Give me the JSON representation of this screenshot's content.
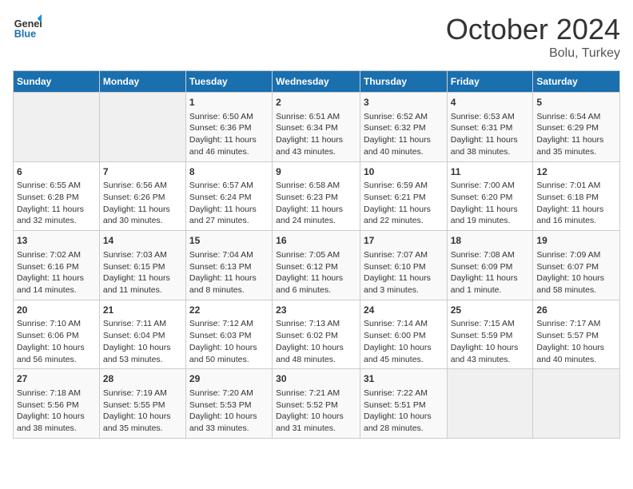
{
  "header": {
    "logo_line1": "General",
    "logo_line2": "Blue",
    "month": "October 2024",
    "location": "Bolu, Turkey"
  },
  "weekdays": [
    "Sunday",
    "Monday",
    "Tuesday",
    "Wednesday",
    "Thursday",
    "Friday",
    "Saturday"
  ],
  "weeks": [
    [
      {
        "day": "",
        "info": ""
      },
      {
        "day": "",
        "info": ""
      },
      {
        "day": "1",
        "info": "Sunrise: 6:50 AM\nSunset: 6:36 PM\nDaylight: 11 hours and 46 minutes."
      },
      {
        "day": "2",
        "info": "Sunrise: 6:51 AM\nSunset: 6:34 PM\nDaylight: 11 hours and 43 minutes."
      },
      {
        "day": "3",
        "info": "Sunrise: 6:52 AM\nSunset: 6:32 PM\nDaylight: 11 hours and 40 minutes."
      },
      {
        "day": "4",
        "info": "Sunrise: 6:53 AM\nSunset: 6:31 PM\nDaylight: 11 hours and 38 minutes."
      },
      {
        "day": "5",
        "info": "Sunrise: 6:54 AM\nSunset: 6:29 PM\nDaylight: 11 hours and 35 minutes."
      }
    ],
    [
      {
        "day": "6",
        "info": "Sunrise: 6:55 AM\nSunset: 6:28 PM\nDaylight: 11 hours and 32 minutes."
      },
      {
        "day": "7",
        "info": "Sunrise: 6:56 AM\nSunset: 6:26 PM\nDaylight: 11 hours and 30 minutes."
      },
      {
        "day": "8",
        "info": "Sunrise: 6:57 AM\nSunset: 6:24 PM\nDaylight: 11 hours and 27 minutes."
      },
      {
        "day": "9",
        "info": "Sunrise: 6:58 AM\nSunset: 6:23 PM\nDaylight: 11 hours and 24 minutes."
      },
      {
        "day": "10",
        "info": "Sunrise: 6:59 AM\nSunset: 6:21 PM\nDaylight: 11 hours and 22 minutes."
      },
      {
        "day": "11",
        "info": "Sunrise: 7:00 AM\nSunset: 6:20 PM\nDaylight: 11 hours and 19 minutes."
      },
      {
        "day": "12",
        "info": "Sunrise: 7:01 AM\nSunset: 6:18 PM\nDaylight: 11 hours and 16 minutes."
      }
    ],
    [
      {
        "day": "13",
        "info": "Sunrise: 7:02 AM\nSunset: 6:16 PM\nDaylight: 11 hours and 14 minutes."
      },
      {
        "day": "14",
        "info": "Sunrise: 7:03 AM\nSunset: 6:15 PM\nDaylight: 11 hours and 11 minutes."
      },
      {
        "day": "15",
        "info": "Sunrise: 7:04 AM\nSunset: 6:13 PM\nDaylight: 11 hours and 8 minutes."
      },
      {
        "day": "16",
        "info": "Sunrise: 7:05 AM\nSunset: 6:12 PM\nDaylight: 11 hours and 6 minutes."
      },
      {
        "day": "17",
        "info": "Sunrise: 7:07 AM\nSunset: 6:10 PM\nDaylight: 11 hours and 3 minutes."
      },
      {
        "day": "18",
        "info": "Sunrise: 7:08 AM\nSunset: 6:09 PM\nDaylight: 11 hours and 1 minute."
      },
      {
        "day": "19",
        "info": "Sunrise: 7:09 AM\nSunset: 6:07 PM\nDaylight: 10 hours and 58 minutes."
      }
    ],
    [
      {
        "day": "20",
        "info": "Sunrise: 7:10 AM\nSunset: 6:06 PM\nDaylight: 10 hours and 56 minutes."
      },
      {
        "day": "21",
        "info": "Sunrise: 7:11 AM\nSunset: 6:04 PM\nDaylight: 10 hours and 53 minutes."
      },
      {
        "day": "22",
        "info": "Sunrise: 7:12 AM\nSunset: 6:03 PM\nDaylight: 10 hours and 50 minutes."
      },
      {
        "day": "23",
        "info": "Sunrise: 7:13 AM\nSunset: 6:02 PM\nDaylight: 10 hours and 48 minutes."
      },
      {
        "day": "24",
        "info": "Sunrise: 7:14 AM\nSunset: 6:00 PM\nDaylight: 10 hours and 45 minutes."
      },
      {
        "day": "25",
        "info": "Sunrise: 7:15 AM\nSunset: 5:59 PM\nDaylight: 10 hours and 43 minutes."
      },
      {
        "day": "26",
        "info": "Sunrise: 7:17 AM\nSunset: 5:57 PM\nDaylight: 10 hours and 40 minutes."
      }
    ],
    [
      {
        "day": "27",
        "info": "Sunrise: 7:18 AM\nSunset: 5:56 PM\nDaylight: 10 hours and 38 minutes."
      },
      {
        "day": "28",
        "info": "Sunrise: 7:19 AM\nSunset: 5:55 PM\nDaylight: 10 hours and 35 minutes."
      },
      {
        "day": "29",
        "info": "Sunrise: 7:20 AM\nSunset: 5:53 PM\nDaylight: 10 hours and 33 minutes."
      },
      {
        "day": "30",
        "info": "Sunrise: 7:21 AM\nSunset: 5:52 PM\nDaylight: 10 hours and 31 minutes."
      },
      {
        "day": "31",
        "info": "Sunrise: 7:22 AM\nSunset: 5:51 PM\nDaylight: 10 hours and 28 minutes."
      },
      {
        "day": "",
        "info": ""
      },
      {
        "day": "",
        "info": ""
      }
    ]
  ]
}
